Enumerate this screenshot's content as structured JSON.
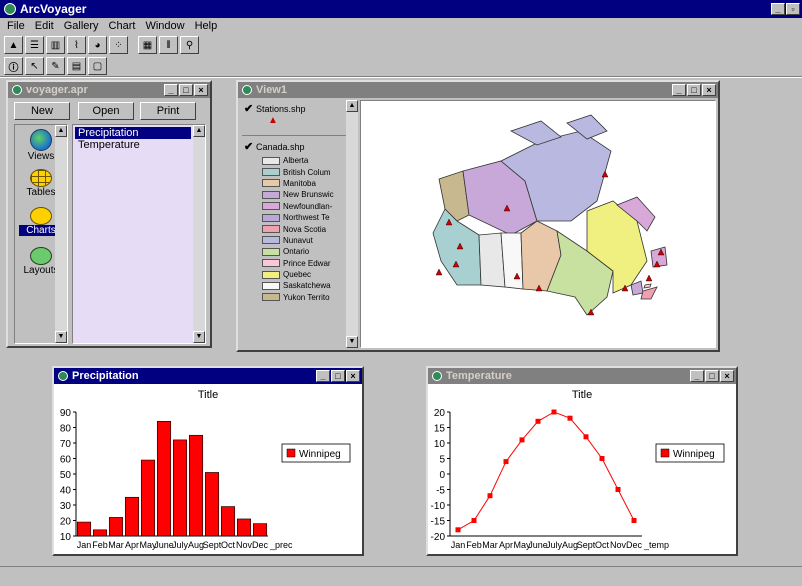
{
  "app": {
    "title": "ArcVoyager"
  },
  "menu": [
    "File",
    "Edit",
    "Gallery",
    "Chart",
    "Window",
    "Help"
  ],
  "project_window": {
    "title": "voyager.apr",
    "buttons": {
      "new": "New",
      "open": "Open",
      "print": "Print"
    },
    "doc_types": [
      "Views",
      "Tables",
      "Charts",
      "Layouts"
    ],
    "selected_type": "Charts",
    "items": [
      "Precipitation",
      "Temperature"
    ],
    "selected_item": "Precipitation"
  },
  "view_window": {
    "title": "View1",
    "themes": [
      {
        "name": "Stations.shp",
        "checked": true,
        "symbol_color": "#cc0000"
      },
      {
        "name": "Canada.shp",
        "checked": true
      }
    ],
    "legend": [
      {
        "label": "Alberta",
        "color": "#e8e8e8"
      },
      {
        "label": "British Colum",
        "color": "#a8d0d0"
      },
      {
        "label": "Manitoba",
        "color": "#e8c8a8"
      },
      {
        "label": "New Brunswic",
        "color": "#c8a8d8"
      },
      {
        "label": "Newfoundlan-",
        "color": "#d8a8d8"
      },
      {
        "label": "Northwest Te",
        "color": "#b8a8d8"
      },
      {
        "label": "Nova Scotia",
        "color": "#f0a0b0"
      },
      {
        "label": "Nunavut",
        "color": "#b8b8e0"
      },
      {
        "label": "Ontario",
        "color": "#c8e0a0"
      },
      {
        "label": "Prince Edwar",
        "color": "#f8c8d8"
      },
      {
        "label": "Quebec",
        "color": "#f0f080"
      },
      {
        "label": "Saskatchewa",
        "color": "#f8f8f8"
      },
      {
        "label": "Yukon Territo",
        "color": "#c8b890"
      }
    ]
  },
  "precip_window": {
    "title": "Precipitation",
    "chart_data": {
      "type": "bar",
      "title": "Title",
      "categories": [
        "Jan",
        "Feb",
        "Mar",
        "Apr",
        "May",
        "June",
        "July",
        "Aug",
        "Sept",
        "Oct",
        "Nov",
        "Dec"
      ],
      "series": [
        {
          "name": "Winnipeg",
          "values": [
            19,
            14,
            22,
            35,
            59,
            84,
            72,
            75,
            51,
            29,
            21,
            18
          ],
          "color": "#ff0000"
        }
      ],
      "ylim": [
        10,
        90
      ],
      "yticks": [
        10,
        20,
        30,
        40,
        50,
        60,
        70,
        80,
        90
      ],
      "extra_xlabel": "_prec",
      "legend": "right"
    }
  },
  "temp_window": {
    "title": "Temperature",
    "chart_data": {
      "type": "line",
      "title": "Title",
      "categories": [
        "Jan",
        "Feb",
        "Mar",
        "Apr",
        "May",
        "June",
        "July",
        "Aug",
        "Sept",
        "Oct",
        "Nov",
        "Dec"
      ],
      "series": [
        {
          "name": "Winnipeg",
          "values": [
            -18,
            -15,
            -7,
            4,
            11,
            17,
            20,
            18,
            12,
            5,
            -5,
            -15
          ],
          "color": "#ff0000"
        }
      ],
      "ylim": [
        -20,
        20
      ],
      "yticks": [
        20,
        15,
        10,
        5,
        0,
        -5,
        -10,
        -15,
        -20
      ],
      "extra_xlabel": "_temp",
      "legend": "right"
    }
  }
}
